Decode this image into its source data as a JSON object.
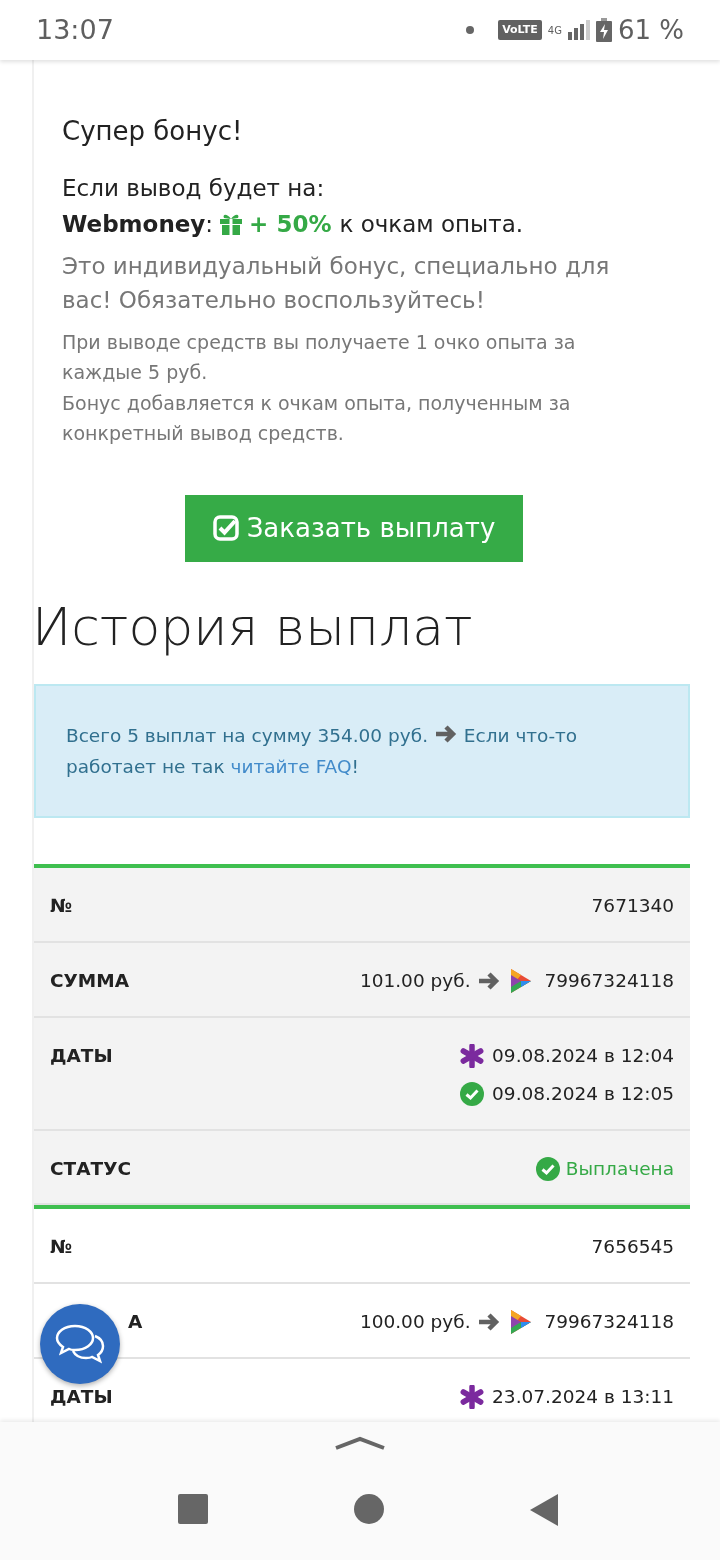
{
  "status_bar": {
    "time": "13:07",
    "network_badge": "VoLTE",
    "network_type": "4G",
    "battery": "61 %"
  },
  "bonus": {
    "title": "Супер бонус!",
    "intro": "Если вывод будет на:",
    "method": "Webmoney",
    "separator": ":",
    "bonus_value": "+ 50%",
    "bonus_tail": "к очкам опыта.",
    "personal_note": "Это индивидуальный бонус, специально для вас! Обязательно воспользуйтесь!",
    "rules": [
      "При выводе средств вы получаете 1 очко опыта за каждые 5 руб.",
      "Бонус добавляется к очкам опыта, полученным за конкретный вывод средств."
    ]
  },
  "order_button": "Заказать выплату",
  "history": {
    "title": "История выплат",
    "summary": "Всего 5 выплат на сумму 354.00 руб.",
    "summary_tail": "Если что-то работает не так",
    "faq_link": "читайте FAQ",
    "summary_end": "!"
  },
  "records": [
    {
      "rows": [
        {
          "kind": "number",
          "label": "№",
          "value": "7671340"
        },
        {
          "kind": "sum",
          "label": "СУММА",
          "amount": "101.00 руб.",
          "account": "79967324118"
        },
        {
          "kind": "dates",
          "label": "ДАТЫ",
          "dates": [
            {
              "kind": "created",
              "text": "09.08.2024 в 12:04"
            },
            {
              "kind": "paid",
              "text": "09.08.2024 в 12:05"
            }
          ]
        },
        {
          "kind": "status",
          "label": "СТАТУС",
          "value": "Выплачена"
        }
      ]
    },
    {
      "rows": [
        {
          "kind": "number",
          "label": "№",
          "value": "7656545"
        },
        {
          "kind": "sum",
          "label": "А",
          "covered": true,
          "amount": "100.00 руб.",
          "account": "79967324118"
        },
        {
          "kind": "dates",
          "label": "ДАТЫ",
          "dates": [
            {
              "kind": "created",
              "text": "23.07.2024 в 13:11"
            }
          ]
        }
      ]
    }
  ]
}
